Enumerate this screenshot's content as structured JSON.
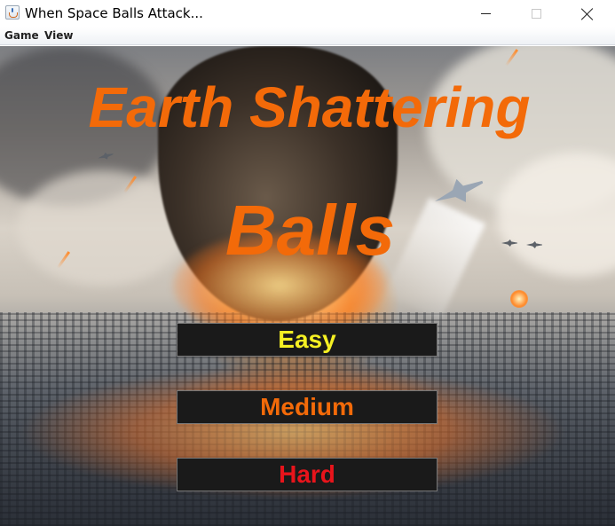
{
  "window": {
    "title": "When Space Balls Attack...",
    "icon": "java-cup-icon"
  },
  "menu": {
    "items": [
      {
        "label": "Game"
      },
      {
        "label": "View"
      }
    ]
  },
  "game": {
    "title_line1": "Earth Shattering",
    "title_line2": "Balls",
    "title_color": "#f36a09",
    "buttons": [
      {
        "label": "Easy",
        "color": "#f5f023"
      },
      {
        "label": "Medium",
        "color": "#f36a09"
      },
      {
        "label": "Hard",
        "color": "#e8141b"
      }
    ],
    "button_background": "#1a1a1a"
  }
}
